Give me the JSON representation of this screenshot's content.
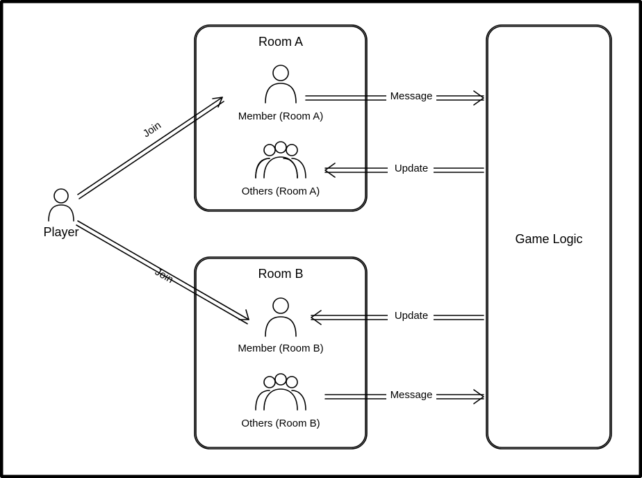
{
  "player": {
    "label": "Player"
  },
  "roomA": {
    "title": "Room A",
    "member": "Member (Room A)",
    "others": "Others (Room A)"
  },
  "roomB": {
    "title": "Room B",
    "member": "Member (Room B)",
    "others": "Others (Room B)"
  },
  "gameLogic": {
    "title": "Game Logic"
  },
  "edges": {
    "joinA": "Join",
    "joinB": "Join",
    "messageA": "Message",
    "updateA": "Update",
    "updateB": "Update",
    "messageB": "Message"
  }
}
